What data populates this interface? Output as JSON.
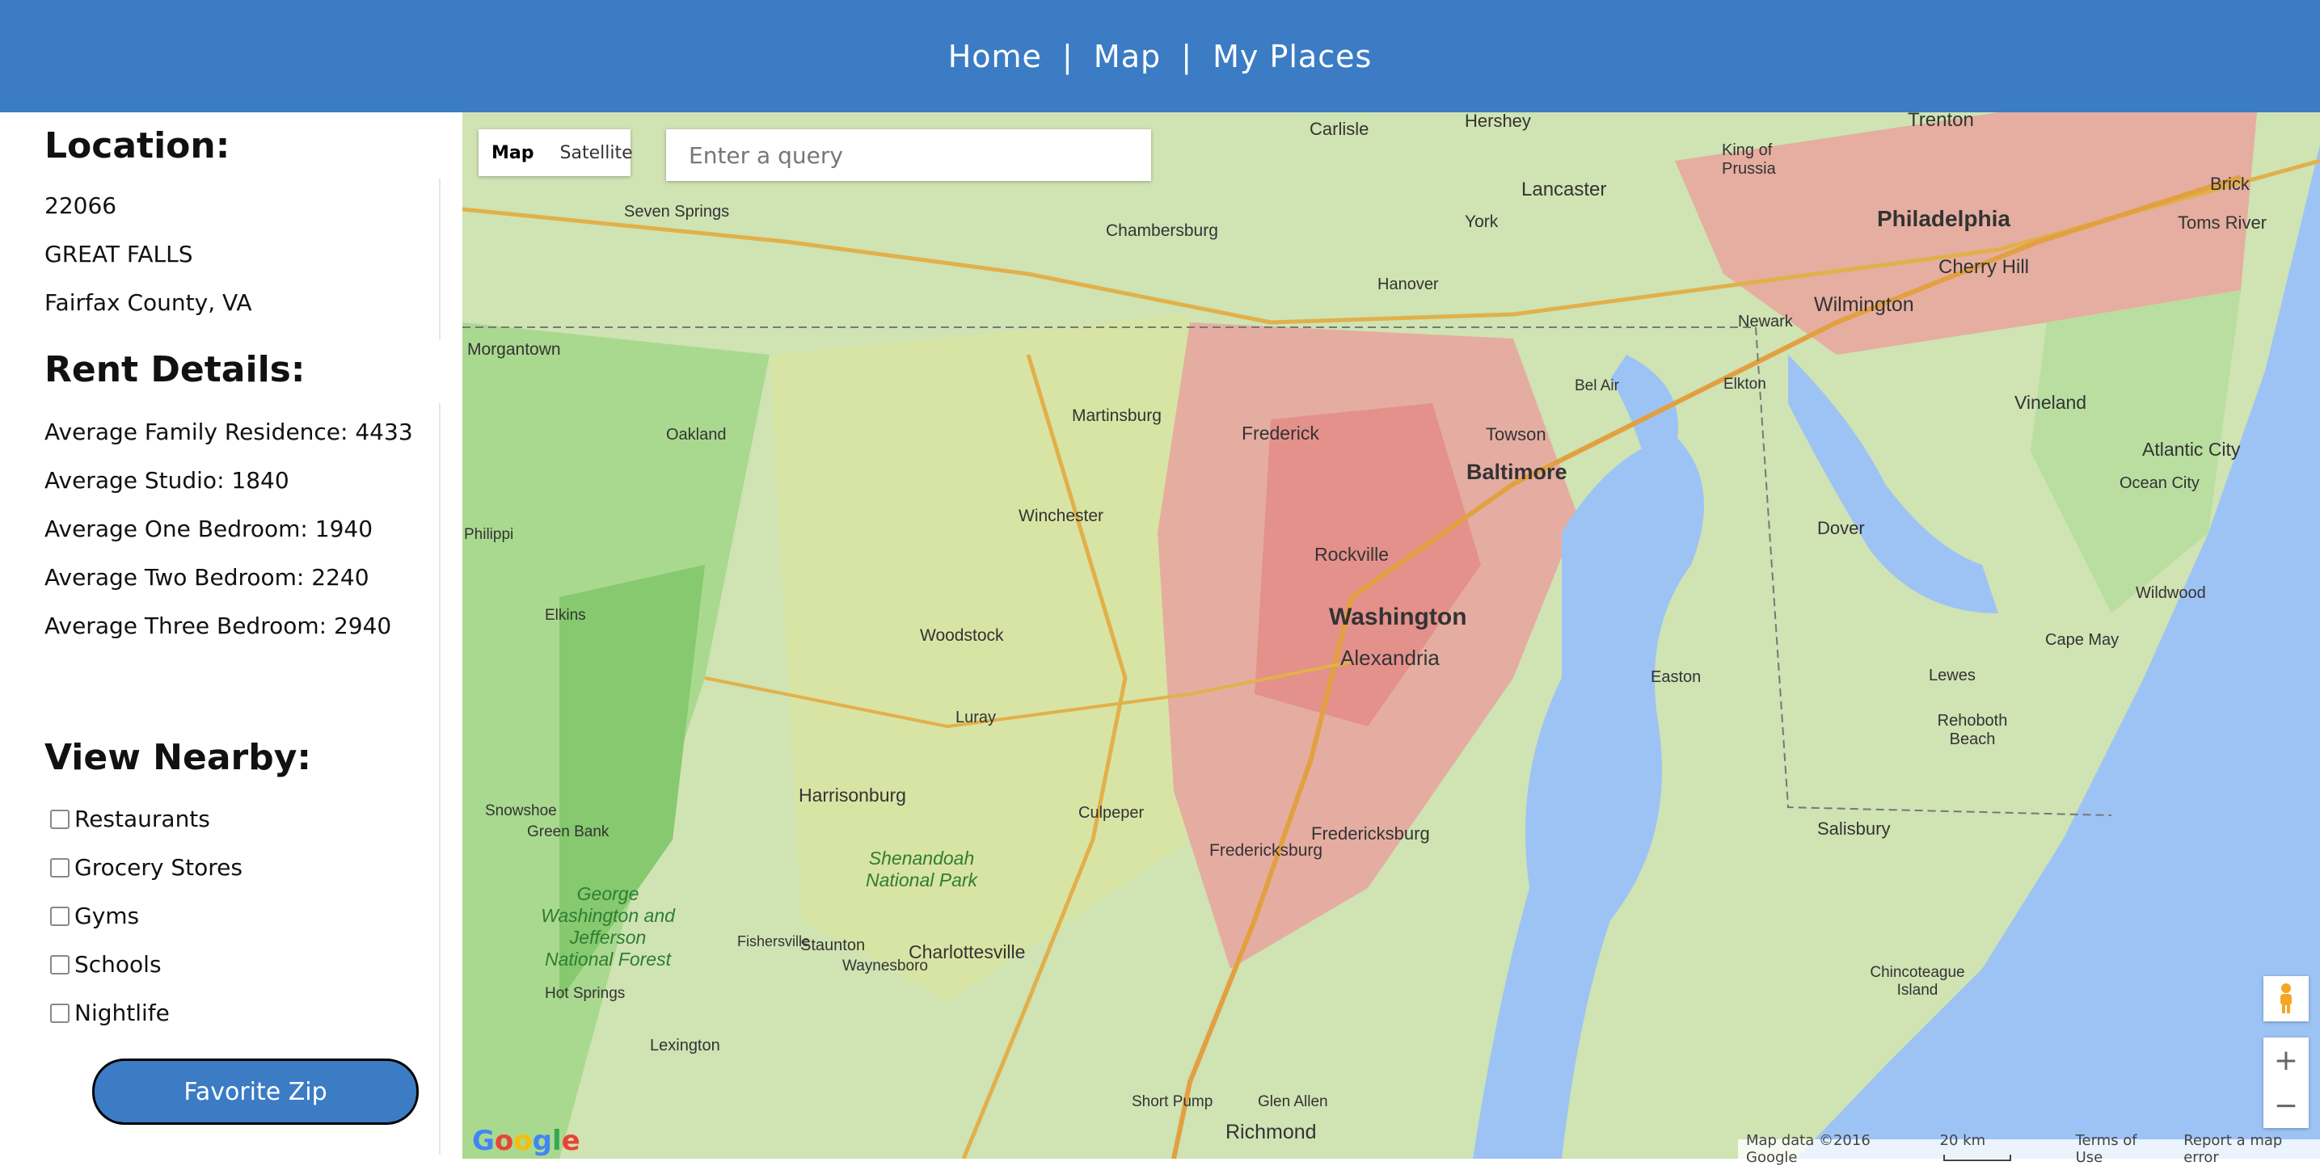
{
  "nav": {
    "home": "Home",
    "sep": "|",
    "map": "Map",
    "places": "My Places"
  },
  "sidebar": {
    "location": {
      "heading": "Location:",
      "zip": "22066",
      "city": "GREAT FALLS",
      "county": "Fairfax County, VA"
    },
    "rent": {
      "heading": "Rent Details:",
      "items": [
        "Average Family Residence: 4433",
        "Average Studio: 1840",
        "Average One Bedroom: 1940",
        "Average Two Bedroom: 2240",
        "Average Three Bedroom: 2940"
      ]
    },
    "nearby": {
      "heading": "View Nearby:",
      "options": [
        "Restaurants",
        "Grocery Stores",
        "Gyms",
        "Schools",
        "Nightlife"
      ]
    },
    "favorite_button": "Favorite Zip"
  },
  "map": {
    "type_options": [
      "Map",
      "Satellite"
    ],
    "selected_type": "Map",
    "search_placeholder": "Enter a query",
    "zoom_in": "+",
    "zoom_out": "−",
    "footer": {
      "data": "Map data ©2016 Google",
      "scale": "20 km",
      "terms": "Terms of Use",
      "report": "Report a map error"
    },
    "logo": "Google",
    "places": [
      "Carlisle",
      "Hershey",
      "Trenton",
      "Lancaster",
      "King of Prussia",
      "Brick",
      "Seven Springs",
      "Chambersburg",
      "York",
      "Philadelphia",
      "Toms River",
      "Hanover",
      "Cherry Hill",
      "Newark",
      "Wilmington",
      "Morgantown",
      "Vineland",
      "Bel Air",
      "Elkton",
      "Atlantic City",
      "Martinsburg",
      "Frederick",
      "Towson",
      "Oakland",
      "Baltimore",
      "Ocean City",
      "Winchester",
      "Dover",
      "Rockville",
      "Washington",
      "Alexandria",
      "Wildwood",
      "Cape May",
      "Woodstock",
      "Lewes",
      "Easton",
      "Rehoboth Beach",
      "Luray",
      "Harrisonburg",
      "Culpeper",
      "Snowshoe",
      "Green Bank",
      "Salisbury",
      "Fredericksburg",
      "Shenandoah National Park",
      "Staunton",
      "George Washington and Jefferson National Forest",
      "Fishersville",
      "Waynesboro",
      "Charlottesville",
      "Chincoteague Island",
      "Hot Springs",
      "Lexington",
      "Short Pump",
      "Glen Allen",
      "Richmond",
      "Philippi",
      "Elkins"
    ]
  }
}
